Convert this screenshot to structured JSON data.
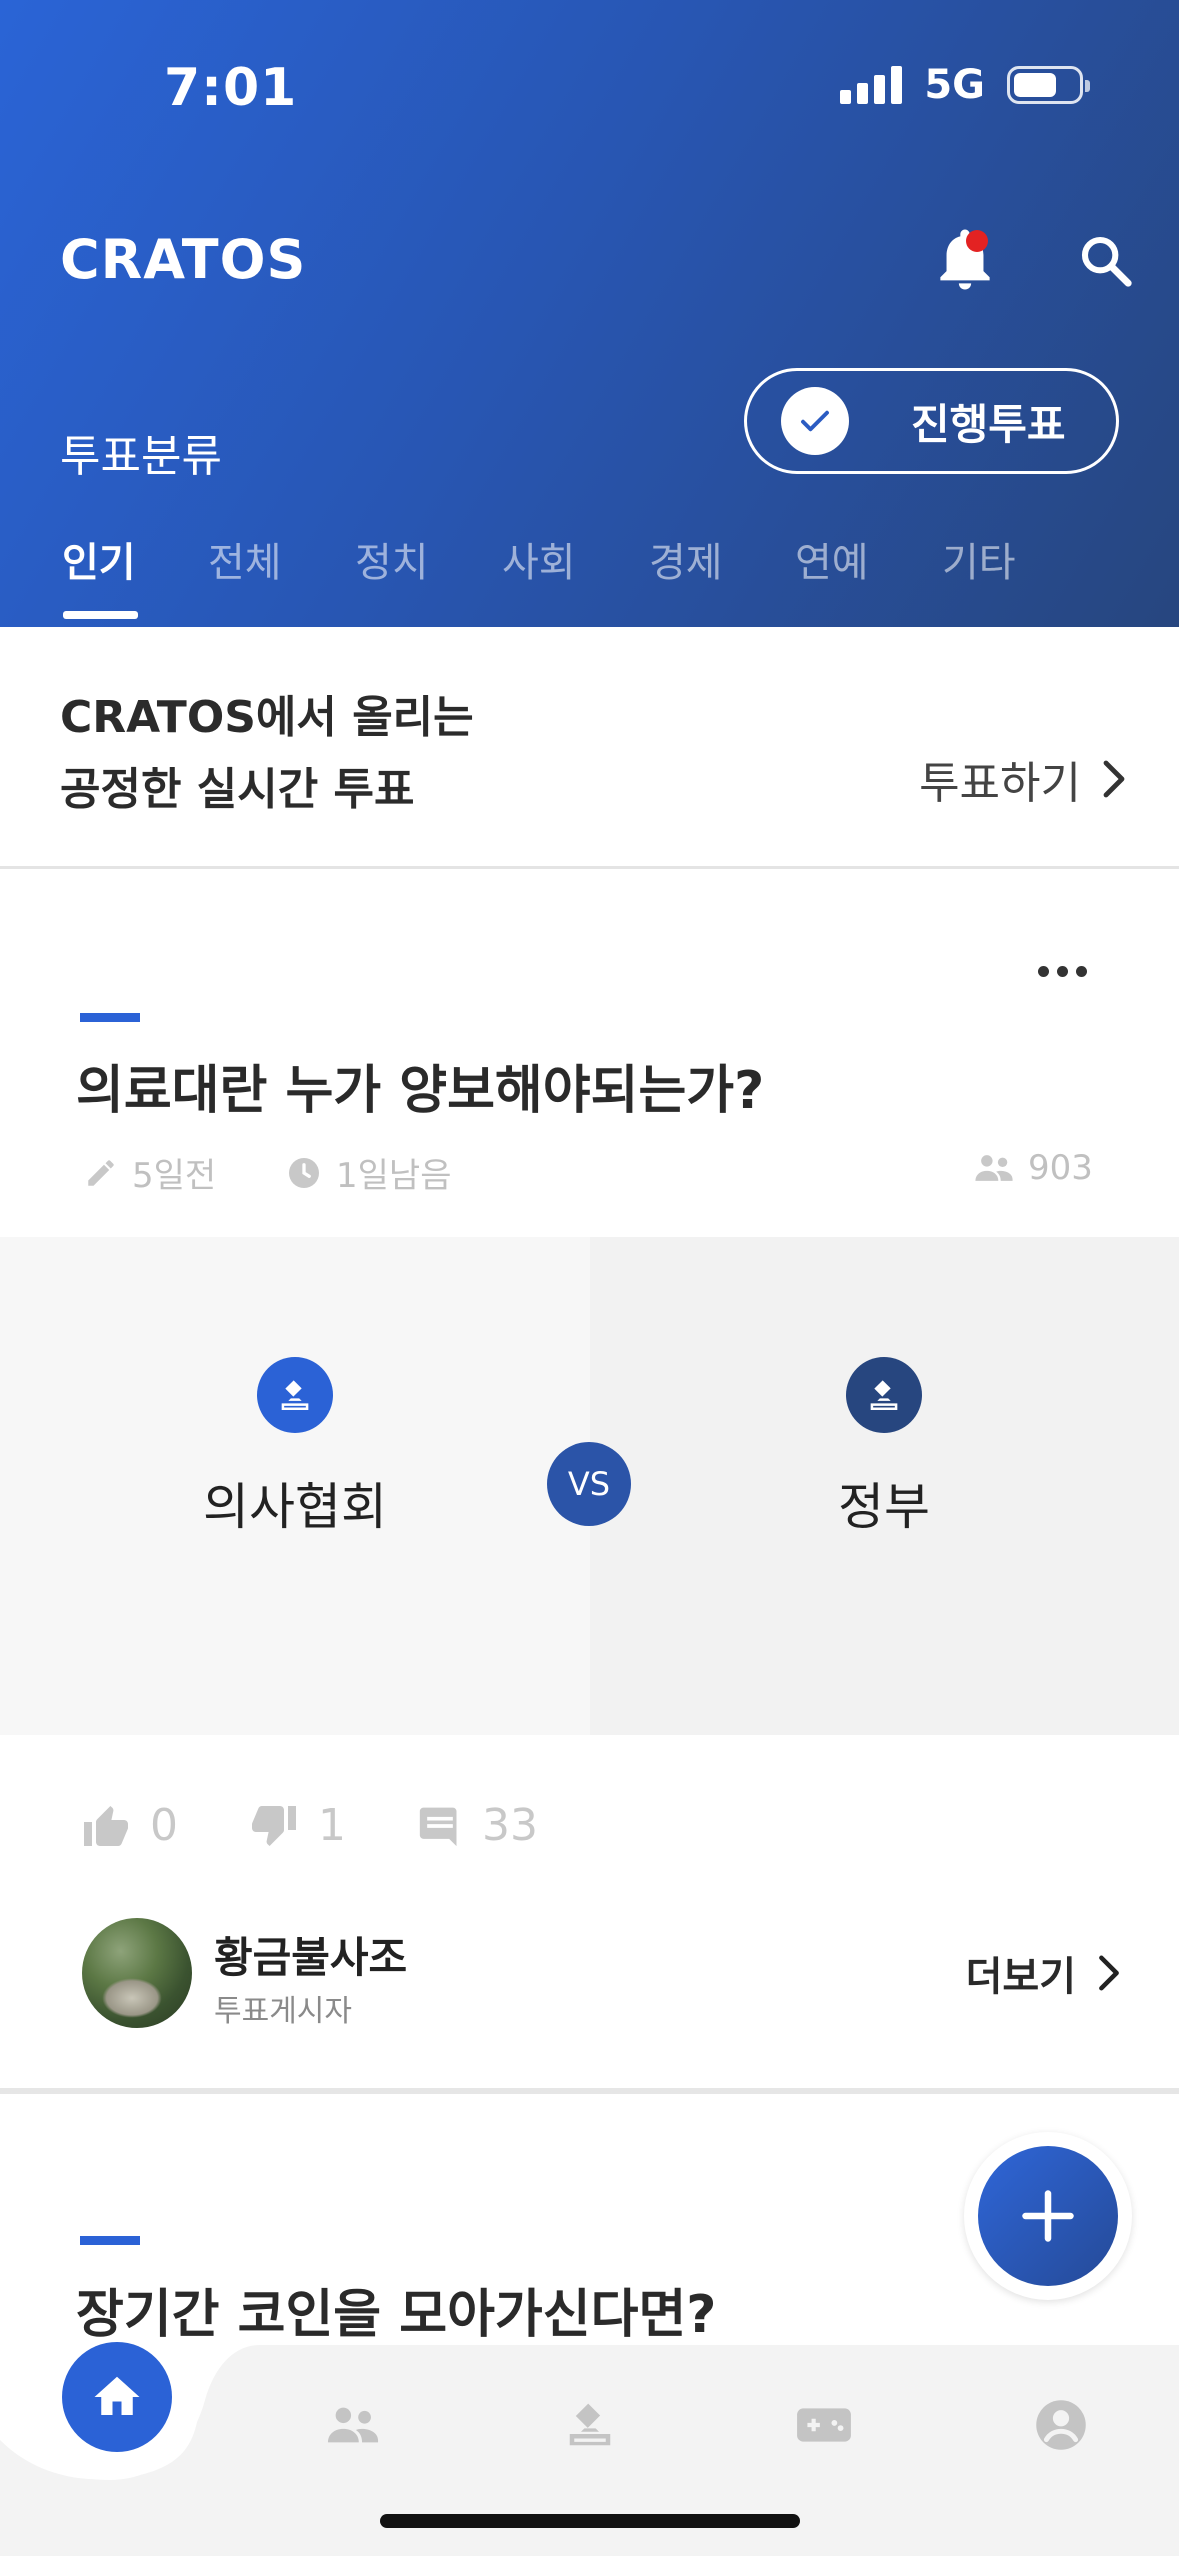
{
  "status_bar": {
    "time": "7:01",
    "network": "5G"
  },
  "header": {
    "app_name": "CRATOS",
    "category_label": "투표분류",
    "progress_button": "진행투표",
    "tabs": [
      {
        "label": "인기",
        "active": true
      },
      {
        "label": "전체",
        "active": false
      },
      {
        "label": "정치",
        "active": false
      },
      {
        "label": "사회",
        "active": false
      },
      {
        "label": "경제",
        "active": false
      },
      {
        "label": "연예",
        "active": false
      },
      {
        "label": "기타",
        "active": false
      }
    ]
  },
  "banner": {
    "line1": "CRATOS에서 올리는",
    "line2": "공정한 실시간 투표",
    "cta": "투표하기"
  },
  "post": {
    "title": "의료대란 누가 양보해야되는가?",
    "posted": "5일전",
    "remaining": "1일남음",
    "participants": "903",
    "option_left": "의사협회",
    "option_right": "정부",
    "vs": "VS",
    "likes": "0",
    "dislikes": "1",
    "comments": "33",
    "author_name": "황금불사조",
    "author_role": "투표게시자",
    "see_more": "더보기"
  },
  "post2": {
    "title": "장기간 코인을 모아가신다면?"
  },
  "colors": {
    "accent": "#2b62d6",
    "header_start": "#2a64d6",
    "header_end": "#27467f",
    "option_left": "#2b62d6",
    "option_right": "#27467f"
  }
}
